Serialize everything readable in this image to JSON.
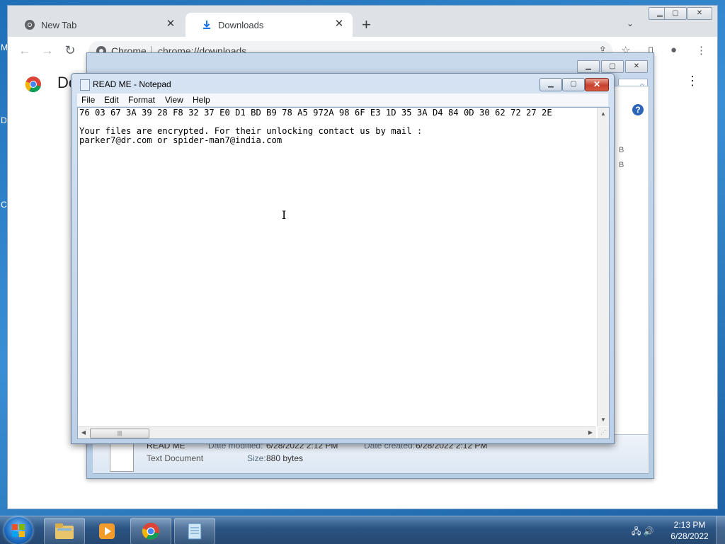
{
  "desktop": {
    "left_letters": [
      "M",
      "D",
      "C"
    ]
  },
  "chrome": {
    "tabs": [
      {
        "label": "New Tab",
        "icon": "chrome-icon"
      },
      {
        "label": "Downloads",
        "icon": "download-icon"
      }
    ],
    "address": {
      "site_label": "Chrome",
      "url": "chrome://downloads"
    },
    "page_title": "Downloads"
  },
  "explorer": {
    "sizes": [
      "B",
      "B"
    ],
    "details": {
      "name": "READ ME",
      "type": "Text Document",
      "modified_label": "Date modified:",
      "modified_value": "6/28/2022 2:12 PM",
      "created_label": "Date created:",
      "created_value": "6/28/2022 2:12 PM",
      "size_label": "Size:",
      "size_value": "880 bytes"
    }
  },
  "notepad": {
    "title": "READ ME - Notepad",
    "menu": [
      "File",
      "Edit",
      "Format",
      "View",
      "Help"
    ],
    "content": "76 03 67 3A 39 28 F8 32 37 E0 D1 BD B9 78 A5 972A 98 6F E3 1D 35 3A D4 84 0D 30 62 72 27 2E\n\nYour files are encrypted. For their unlocking contact us by mail :\nparker7@dr.com or spider-man7@india.com"
  },
  "taskbar": {
    "items": [
      "windows-explorer",
      "media-player",
      "chrome",
      "notepad"
    ],
    "clock_time": "2:13 PM",
    "clock_date": "6/28/2022"
  }
}
